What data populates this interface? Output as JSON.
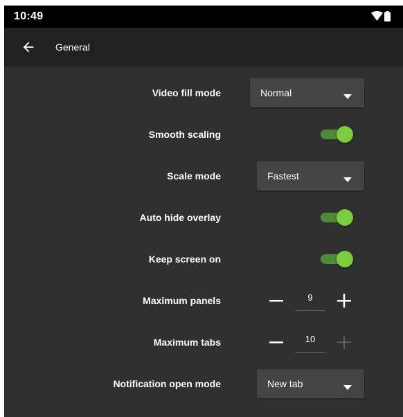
{
  "status_bar": {
    "time": "10:49"
  },
  "app_bar": {
    "title": "General"
  },
  "settings": {
    "video_fill_mode": {
      "label": "Video fill mode",
      "value": "Normal"
    },
    "smooth_scaling": {
      "label": "Smooth scaling",
      "checked": true
    },
    "scale_mode": {
      "label": "Scale mode",
      "value": "Fastest"
    },
    "auto_hide_overlay": {
      "label": "Auto hide overlay",
      "checked": true
    },
    "keep_screen_on": {
      "label": "Keep screen on",
      "checked": true
    },
    "maximum_panels": {
      "label": "Maximum panels",
      "value": "9"
    },
    "maximum_tabs": {
      "label": "Maximum tabs",
      "value": "10"
    },
    "notification_open_mode": {
      "label": "Notification open mode",
      "value": "New tab"
    }
  },
  "colors": {
    "background": "#303030",
    "app_bar": "#212121",
    "switch_track": "#4f8a37",
    "switch_thumb": "#7ccc3e",
    "dropdown": "#444444"
  }
}
